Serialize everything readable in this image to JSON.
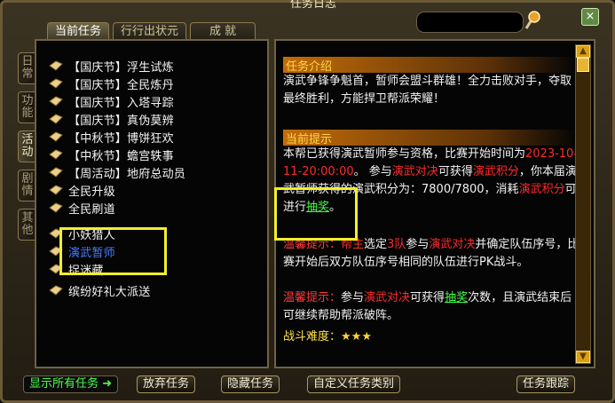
{
  "window": {
    "title": "任务日志",
    "close_label": "×"
  },
  "tabs": [
    {
      "label": "当前任务",
      "active": true
    },
    {
      "label": "行行出状元",
      "active": false
    },
    {
      "label": "成 就",
      "active": false
    }
  ],
  "search": {
    "value": ""
  },
  "side_tabs": [
    "日常",
    "功能",
    "活动",
    "剧情",
    "其他"
  ],
  "quests": [
    {
      "label": "【国庆节】浮生试炼"
    },
    {
      "label": "【国庆节】全民炼丹"
    },
    {
      "label": "【国庆节】入塔寻踪"
    },
    {
      "label": "【国庆节】真伪莫辨"
    },
    {
      "label": "【中秋节】博饼狂欢"
    },
    {
      "label": "【中秋节】蟾宫轶事"
    },
    {
      "label": "【周活动】地府总动员"
    },
    {
      "label": "全民升级"
    },
    {
      "label": "全民刷道"
    },
    {
      "label": "小妖猎人"
    },
    {
      "label": "演武暂师"
    },
    {
      "label": "捉迷藏"
    },
    {
      "label": "缤纷好礼大派送"
    }
  ],
  "detail": {
    "intro_header": "任务介绍",
    "intro_text": "演武争锋争魁首，暂师会盟斗群雄！全力击败对手，夺取最终胜利，方能捍卫帮派荣耀！",
    "hint_header": "当前提示",
    "hint_a": "本帮已获得演武暂师参与资格，比赛开始时间为",
    "hint_time": "2023-10-11-20:00:00",
    "hint_b": "。",
    "hint_c": "参与",
    "link_duel": "演武对决",
    "hint_d": "可获得",
    "link_points": "演武积分",
    "hint_e": "，你本届演武暂师获得的演武积分为：7800/7800，消耗",
    "hint_f": "可进行",
    "link_lottery": "抽奖",
    "hint_g": "。",
    "warm_label": "温馨提示：",
    "warm1_a": "帮主",
    "warm1_b": "选定",
    "warm1_c": "3队",
    "warm1_d": "参与",
    "warm1_e": "并确定队伍序号，比赛开始后双方队伍序号相同的队伍进行PK战斗。",
    "warm2_a": "参与",
    "warm2_b": "可获得",
    "warm2_c": "次数，且演武结束后可继续帮助帮派破阵。",
    "difficulty_label": "战斗难度：",
    "difficulty_stars": "★★★"
  },
  "bottom": {
    "show_all": "显示所有任务",
    "abandon": "放弃任务",
    "hide": "隐藏任务",
    "custom": "自定义任务类别",
    "track": "任务跟踪"
  },
  "colors": {
    "accent": "#ffd84a",
    "link_red": "#ff2a2a",
    "link_green": "#46ff46",
    "highlight": "#f3ef2b"
  }
}
